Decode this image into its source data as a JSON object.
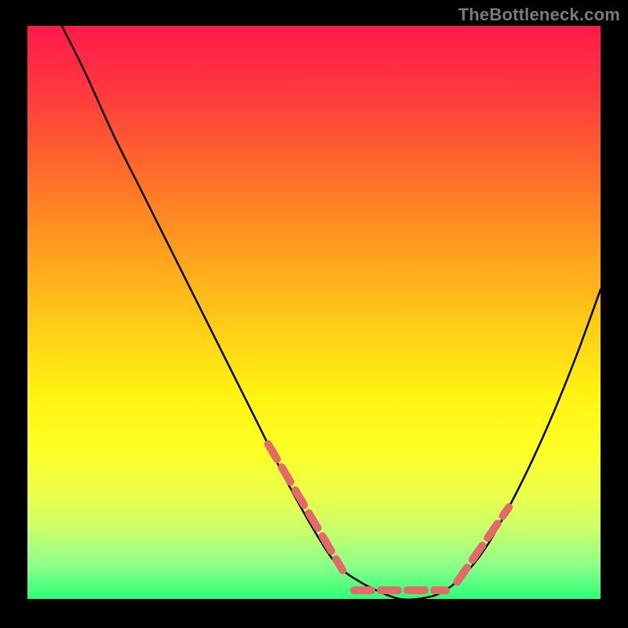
{
  "attribution": "TheBottleneck.com",
  "chart_data": {
    "type": "line",
    "title": "",
    "xlabel": "",
    "ylabel": "",
    "xlim": [
      0,
      100
    ],
    "ylim": [
      0,
      100
    ],
    "series": [
      {
        "name": "bottleneck-curve",
        "x": [
          6,
          10,
          15,
          20,
          25,
          30,
          35,
          40,
          45,
          50,
          54,
          58,
          62,
          65,
          68,
          72,
          76,
          80,
          84,
          88,
          92,
          96,
          100
        ],
        "y": [
          100,
          92,
          81,
          71,
          61,
          51,
          41,
          31,
          21,
          12,
          6,
          3,
          1,
          0,
          0,
          1,
          4,
          9,
          16,
          24,
          33,
          43,
          54
        ]
      }
    ],
    "overlay_segments": [
      {
        "name": "left-overlay",
        "x": [
          42,
          55
        ],
        "y": [
          27,
          5
        ]
      },
      {
        "name": "right-overlay",
        "x": [
          75,
          84
        ],
        "y": [
          3,
          16
        ]
      }
    ],
    "flat_segments": [
      {
        "name": "valley-flat",
        "x": [
          57,
          73
        ],
        "y": [
          1.5,
          1.5
        ]
      }
    ]
  },
  "colors": {
    "curve": "#000000",
    "overlay_dash": "#e46a6a",
    "background_top": "#ff1a4b",
    "background_bottom": "#2cff77"
  }
}
